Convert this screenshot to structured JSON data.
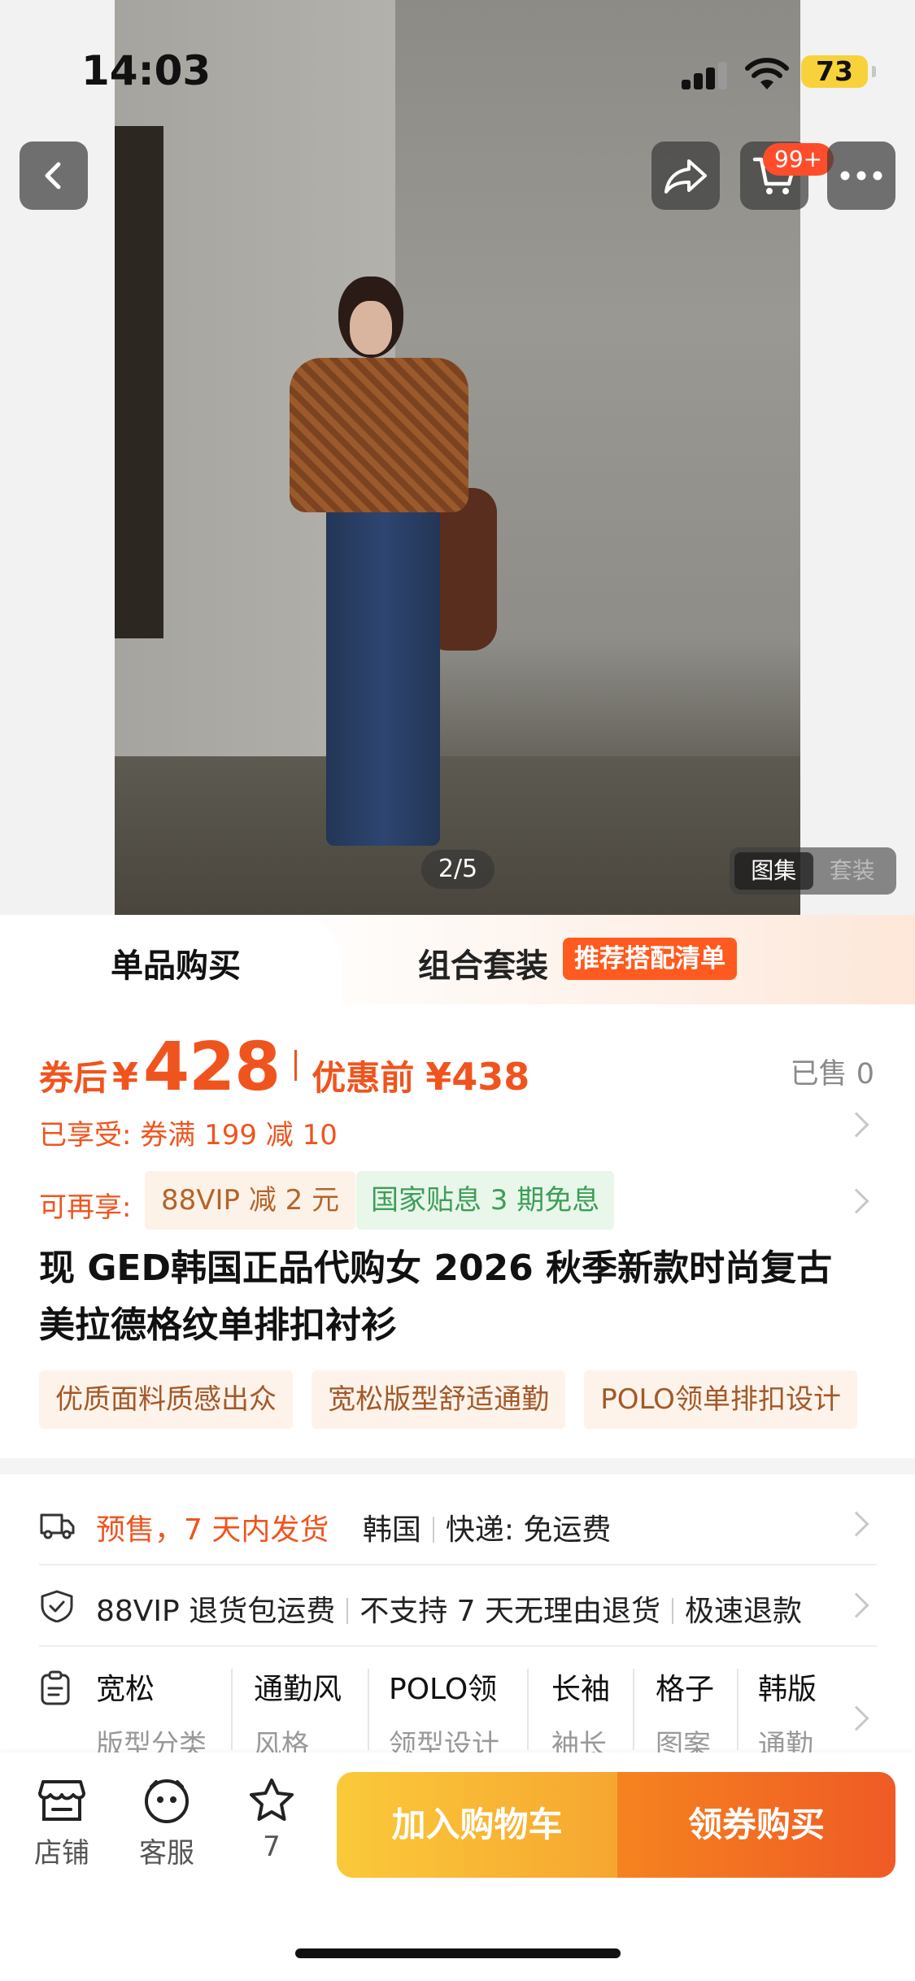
{
  "status_bar": {
    "time": "14:03",
    "battery": "73"
  },
  "header": {
    "cart_badge": "99+"
  },
  "gallery": {
    "page_indicator": "2/5",
    "toggle": [
      "图集",
      "套装"
    ]
  },
  "tabs": {
    "single": "单品购买",
    "combo": "组合套装",
    "combo_tag": "推荐搭配清单"
  },
  "price": {
    "after_coupon_label": "券后",
    "currency": "¥",
    "after_coupon_value": "428",
    "before_label": "优惠前",
    "before_value": "¥438",
    "sold": "已售 0"
  },
  "coupon": {
    "enjoyed": "已享受: 券满 199 减 10"
  },
  "extra": {
    "label": "可再享:",
    "vip": "88VIP 减 2 元",
    "gov": "国家贴息 3 期免息"
  },
  "product": {
    "title_line1": "现 GED韩国正品代购女 2026 秋季新款时尚复古",
    "title_line2": "美拉德格纹单排扣衬衫"
  },
  "features": [
    "优质面料质感出众",
    "宽松版型舒适通勤",
    "POLO领单排扣设计"
  ],
  "shipping": {
    "presale": "预售，7 天内发货",
    "origin": "韩国",
    "delivery": "快递: 免运费"
  },
  "service": {
    "return_fee": "88VIP 退货包运费",
    "no_reason": "不支持 7 天无理由退货",
    "refund": "极速退款"
  },
  "attributes": [
    {
      "value": "宽松",
      "key": "版型分类"
    },
    {
      "value": "通勤风",
      "key": "风格"
    },
    {
      "value": "POLO领",
      "key": "领型设计"
    },
    {
      "value": "长袖",
      "key": "袖长"
    },
    {
      "value": "格子",
      "key": "图案"
    },
    {
      "value": "韩版",
      "key": "通勤"
    }
  ],
  "bottom_bar": {
    "shop": "店铺",
    "service": "客服",
    "favorites": "7",
    "add_cart": "加入购物车",
    "buy": "领券购买"
  }
}
